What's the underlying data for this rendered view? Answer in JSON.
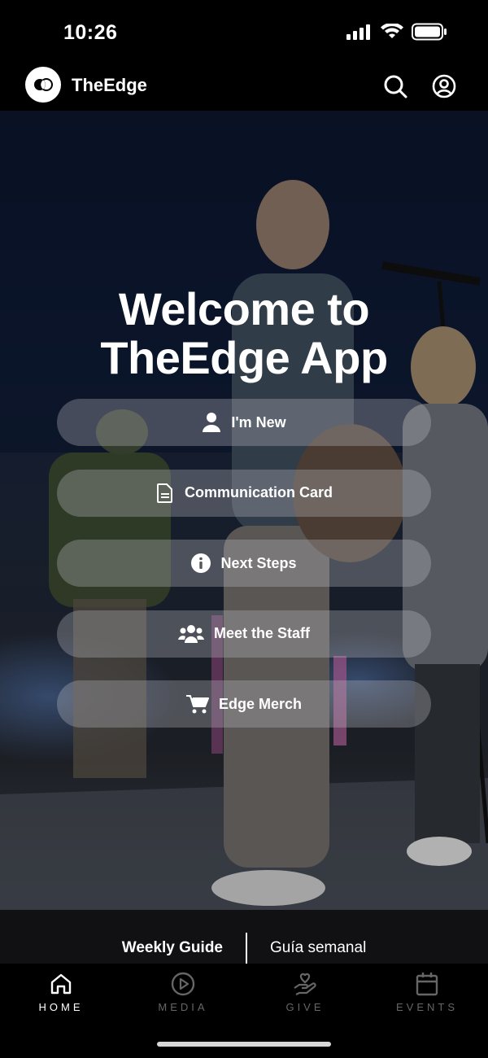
{
  "status": {
    "time": "10:26"
  },
  "header": {
    "title": "TheEdge"
  },
  "hero": {
    "line1": "Welcome to",
    "line2": "TheEdge App",
    "buttons": [
      {
        "label": "I'm New",
        "icon": "person-icon"
      },
      {
        "label": "Communication Card",
        "icon": "document-icon"
      },
      {
        "label": "Next Steps",
        "icon": "info-icon"
      },
      {
        "label": "Meet the Staff",
        "icon": "people-icon"
      },
      {
        "label": "Edge Merch",
        "icon": "cart-icon"
      }
    ]
  },
  "guide": {
    "left": "Weekly Guide",
    "right": "Guía semanal"
  },
  "nav": [
    {
      "label": "HOME",
      "icon": "home-icon",
      "active": true
    },
    {
      "label": "MEDIA",
      "icon": "play-icon",
      "active": false
    },
    {
      "label": "GIVE",
      "icon": "give-icon",
      "active": false
    },
    {
      "label": "EVENTS",
      "icon": "calendar-icon",
      "active": false
    }
  ],
  "colors": {
    "background": "#000000",
    "text": "#ffffff",
    "inactive": "#666666",
    "button": "rgba(190,190,195,0.32)"
  }
}
